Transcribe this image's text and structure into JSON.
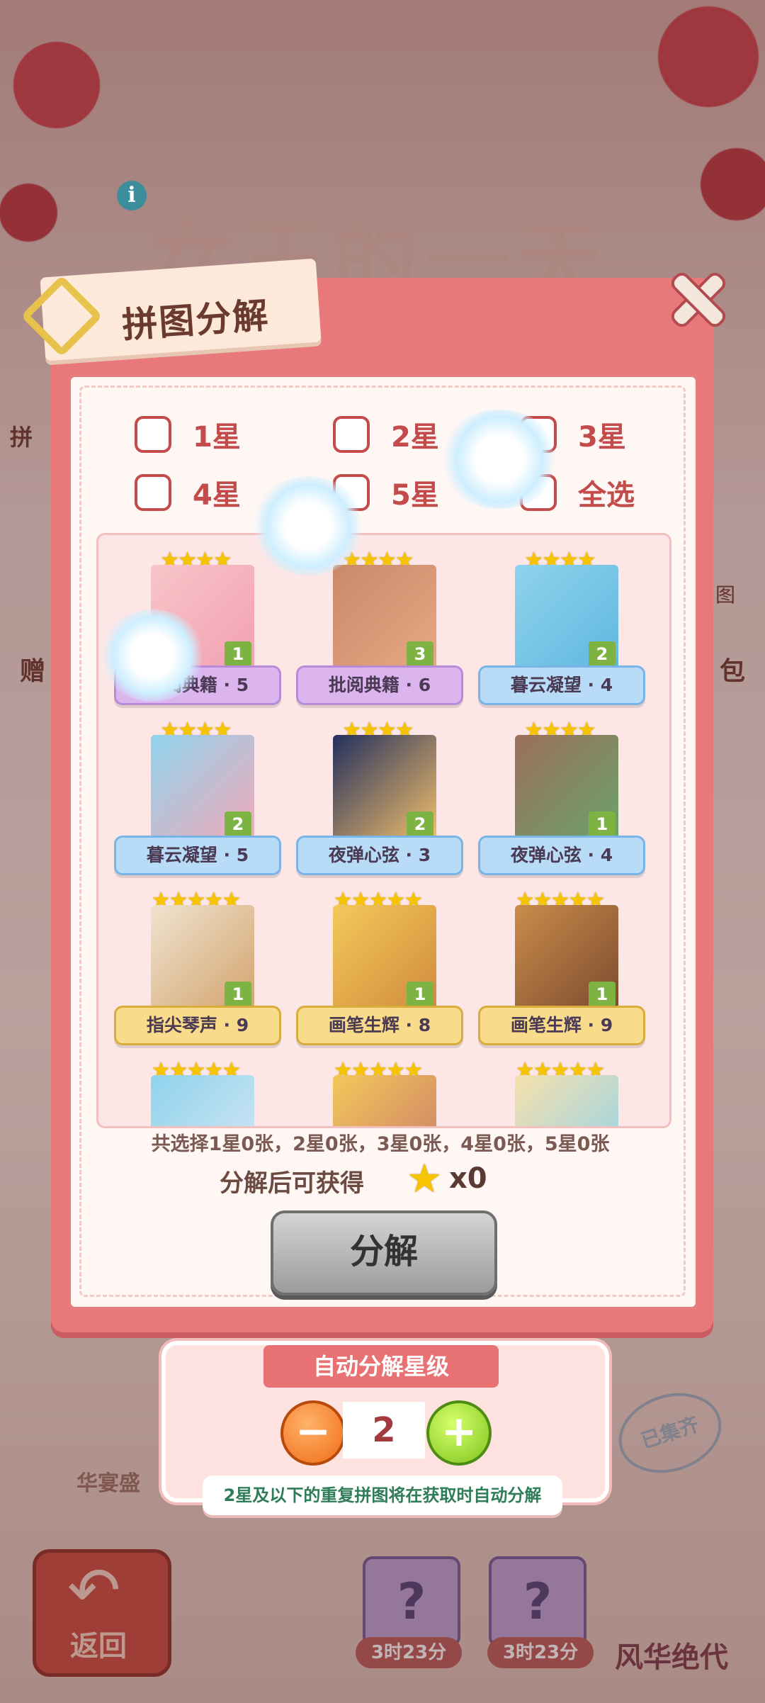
{
  "background": {
    "game_title": "女王的一天",
    "side_left": "拼",
    "side_right": "图",
    "side_gift_left": "赠",
    "side_gift_right": "包",
    "feast_label": "华宴盛",
    "collected_stamp": "已集齐",
    "back_label": "返回",
    "timer_1": "3时23分",
    "timer_2": "3时23分",
    "card_glyph": "?",
    "character_label": "风华绝代"
  },
  "dialog": {
    "title": "拼图分解",
    "filters": [
      {
        "label": "1星"
      },
      {
        "label": "2星"
      },
      {
        "label": "3星"
      },
      {
        "label": "4星"
      },
      {
        "label": "5星"
      },
      {
        "label": "全选"
      }
    ],
    "cards": [
      {
        "name": "批阅典籍 · 5",
        "stars": "★★★★",
        "count": "1",
        "style": "purple"
      },
      {
        "name": "批阅典籍 · 6",
        "stars": "★★★★",
        "count": "3",
        "style": "purple"
      },
      {
        "name": "暮云凝望 · 4",
        "stars": "★★★★",
        "count": "2",
        "style": "blue"
      },
      {
        "name": "暮云凝望 · 5",
        "stars": "★★★★",
        "count": "2",
        "style": "blue"
      },
      {
        "name": "夜弹心弦 · 3",
        "stars": "★★★★",
        "count": "2",
        "style": "blue"
      },
      {
        "name": "夜弹心弦 · 4",
        "stars": "★★★★",
        "count": "1",
        "style": "blue"
      },
      {
        "name": "指尖琴声 · 9",
        "stars": "★★★★★",
        "count": "1",
        "style": "gold"
      },
      {
        "name": "画笔生辉 · 8",
        "stars": "★★★★★",
        "count": "1",
        "style": "gold"
      },
      {
        "name": "画笔生辉 · 9",
        "stars": "★★★★★",
        "count": "1",
        "style": "gold"
      },
      {
        "name": "",
        "stars": "★★★★★",
        "count": "",
        "style": "gold"
      },
      {
        "name": "",
        "stars": "★★★★★",
        "count": "",
        "style": "gold"
      },
      {
        "name": "",
        "stars": "★★★★★",
        "count": "",
        "style": "gold"
      }
    ],
    "summary": "共选择1星0张，2星0张，3星0张，4星0张，5星0张",
    "gain_label": "分解后可获得",
    "gain_value": "x0",
    "decompose_label": "分解"
  },
  "auto": {
    "title": "自动分解星级",
    "minus": "−",
    "plus": "+",
    "value": "2",
    "note": "2星及以下的重复拼图将在获取时自动分解"
  },
  "colors": {
    "accent": "#e8787a",
    "check_border": "#c34b4b",
    "star": "#f7c400",
    "count_badge": "#7cb342",
    "note_text": "#2f7c59"
  },
  "icons": [
    "info-icon",
    "close-icon",
    "star-icon",
    "minus-icon",
    "plus-icon",
    "back-arrow-icon"
  ]
}
